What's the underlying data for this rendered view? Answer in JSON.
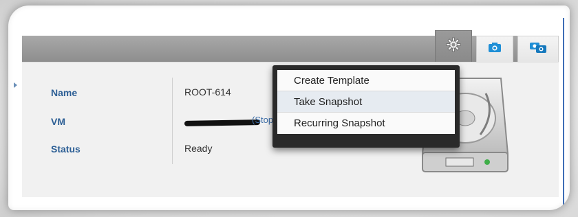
{
  "toolbar": {
    "gear_icon": "gear-icon",
    "snapshot_icon": "camera-icon",
    "recurring_icon": "camera-recurring-icon"
  },
  "details": {
    "name_label": "Name",
    "name_value": "ROOT-614",
    "vm_label": "VM",
    "vm_status": "(Stopp",
    "status_label": "Status",
    "status_value": "Ready"
  },
  "menu": {
    "items": [
      {
        "label": "Create Template"
      },
      {
        "label": "Take Snapshot"
      },
      {
        "label": "Recurring Snapshot"
      }
    ]
  },
  "colors": {
    "label": "#2d5f95",
    "link": "#3d6ea8",
    "menu_highlight": "#e6ebf1"
  }
}
